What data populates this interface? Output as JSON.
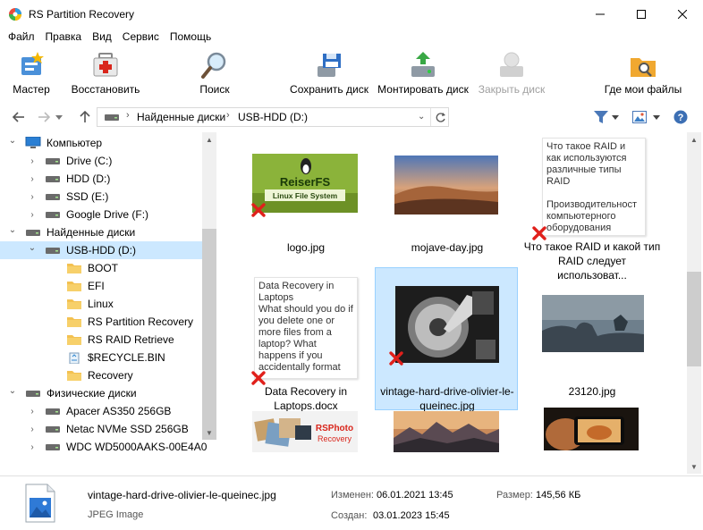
{
  "window": {
    "title": "RS Partition Recovery"
  },
  "menu": [
    "Файл",
    "Правка",
    "Вид",
    "Сервис",
    "Помощь"
  ],
  "toolbar": {
    "wizard": "Мастер",
    "restore": "Восстановить",
    "search": "Поиск",
    "save_disk": "Сохранить диск",
    "mount_disk": "Монтировать диск",
    "close_disk": "Закрыть диск",
    "where_files": "Где мои файлы"
  },
  "address": {
    "crumbs": [
      "Найденные диски",
      "USB-HDD (D:)"
    ]
  },
  "tree": [
    {
      "label": "Компьютер",
      "level": 0,
      "expanded": true,
      "icon": "computer-icon"
    },
    {
      "label": "Drive (C:)",
      "level": 1,
      "icon": "drive-icon"
    },
    {
      "label": "HDD (D:)",
      "level": 1,
      "icon": "drive-icon"
    },
    {
      "label": "SSD (E:)",
      "level": 1,
      "icon": "drive-icon"
    },
    {
      "label": "Google Drive (F:)",
      "level": 1,
      "icon": "drive-icon"
    },
    {
      "label": "Найденные диски",
      "level": 0,
      "expanded": true,
      "icon": "drive-icon"
    },
    {
      "label": "USB-HDD (D:)",
      "level": 1,
      "expanded": true,
      "selected": true,
      "icon": "drive-icon"
    },
    {
      "label": "BOOT",
      "level": 2,
      "icon": "folder-icon"
    },
    {
      "label": "EFI",
      "level": 2,
      "icon": "folder-icon"
    },
    {
      "label": "Linux",
      "level": 2,
      "icon": "folder-icon"
    },
    {
      "label": "RS Partition Recovery",
      "level": 2,
      "icon": "folder-icon"
    },
    {
      "label": "RS RAID Retrieve",
      "level": 2,
      "icon": "folder-icon"
    },
    {
      "label": "$RECYCLE.BIN",
      "level": 2,
      "icon": "recycle-bin-icon"
    },
    {
      "label": "Recovery",
      "level": 2,
      "icon": "folder-icon"
    },
    {
      "label": "Физические диски",
      "level": 0,
      "expanded": true,
      "icon": "drive-icon"
    },
    {
      "label": "Apacer AS350 256GB",
      "level": 1,
      "icon": "drive-icon"
    },
    {
      "label": "Netac NVMe SSD 256GB",
      "level": 1,
      "icon": "drive-icon"
    },
    {
      "label": "WDC WD5000AAKS-00E4A0",
      "level": 1,
      "icon": "drive-icon"
    }
  ],
  "files": [
    {
      "caption": "logo.jpg",
      "kind": "reiserfs",
      "deleted": true,
      "thumb_text": [
        "ReiserFS",
        "Linux File System"
      ]
    },
    {
      "caption": "mojave-day.jpg",
      "kind": "mojave",
      "deleted": false
    },
    {
      "caption": "Что такое RAID и какой тип RAID следует использоват...",
      "kind": "doc",
      "deleted": true,
      "doc_text": "Что такое RAID и как используются различные типы RAID\n\nПроизводительност компьютерного оборудования"
    },
    {
      "caption": "Data Recovery in Laptops.docx",
      "kind": "doc",
      "deleted": true,
      "doc_text": "Data Recovery in Laptops\nWhat should you do if you delete one or more files from a laptop? What happens if you accidentally format"
    },
    {
      "caption": "vintage-hard-drive-olivier-le-queinec.jpg",
      "kind": "harddrive",
      "deleted": true,
      "selected": true
    },
    {
      "caption": "23120.jpg",
      "kind": "rocks",
      "deleted": false
    },
    {
      "caption": "",
      "kind": "rsphoto",
      "deleted": false,
      "thumb_text": [
        "RSPhoto",
        "Recovery"
      ]
    },
    {
      "caption": "",
      "kind": "mountains",
      "deleted": false
    },
    {
      "caption": "",
      "kind": "phone",
      "deleted": false
    }
  ],
  "status": {
    "filename": "vintage-hard-drive-olivier-le-queinec.jpg",
    "filetype": "JPEG Image",
    "modified_label": "Изменен:",
    "modified_value": "06.01.2021 13:45",
    "created_label": "Создан:",
    "created_value": "03.01.2023 15:45",
    "size_label": "Размер:",
    "size_value": "145,56 КБ"
  }
}
